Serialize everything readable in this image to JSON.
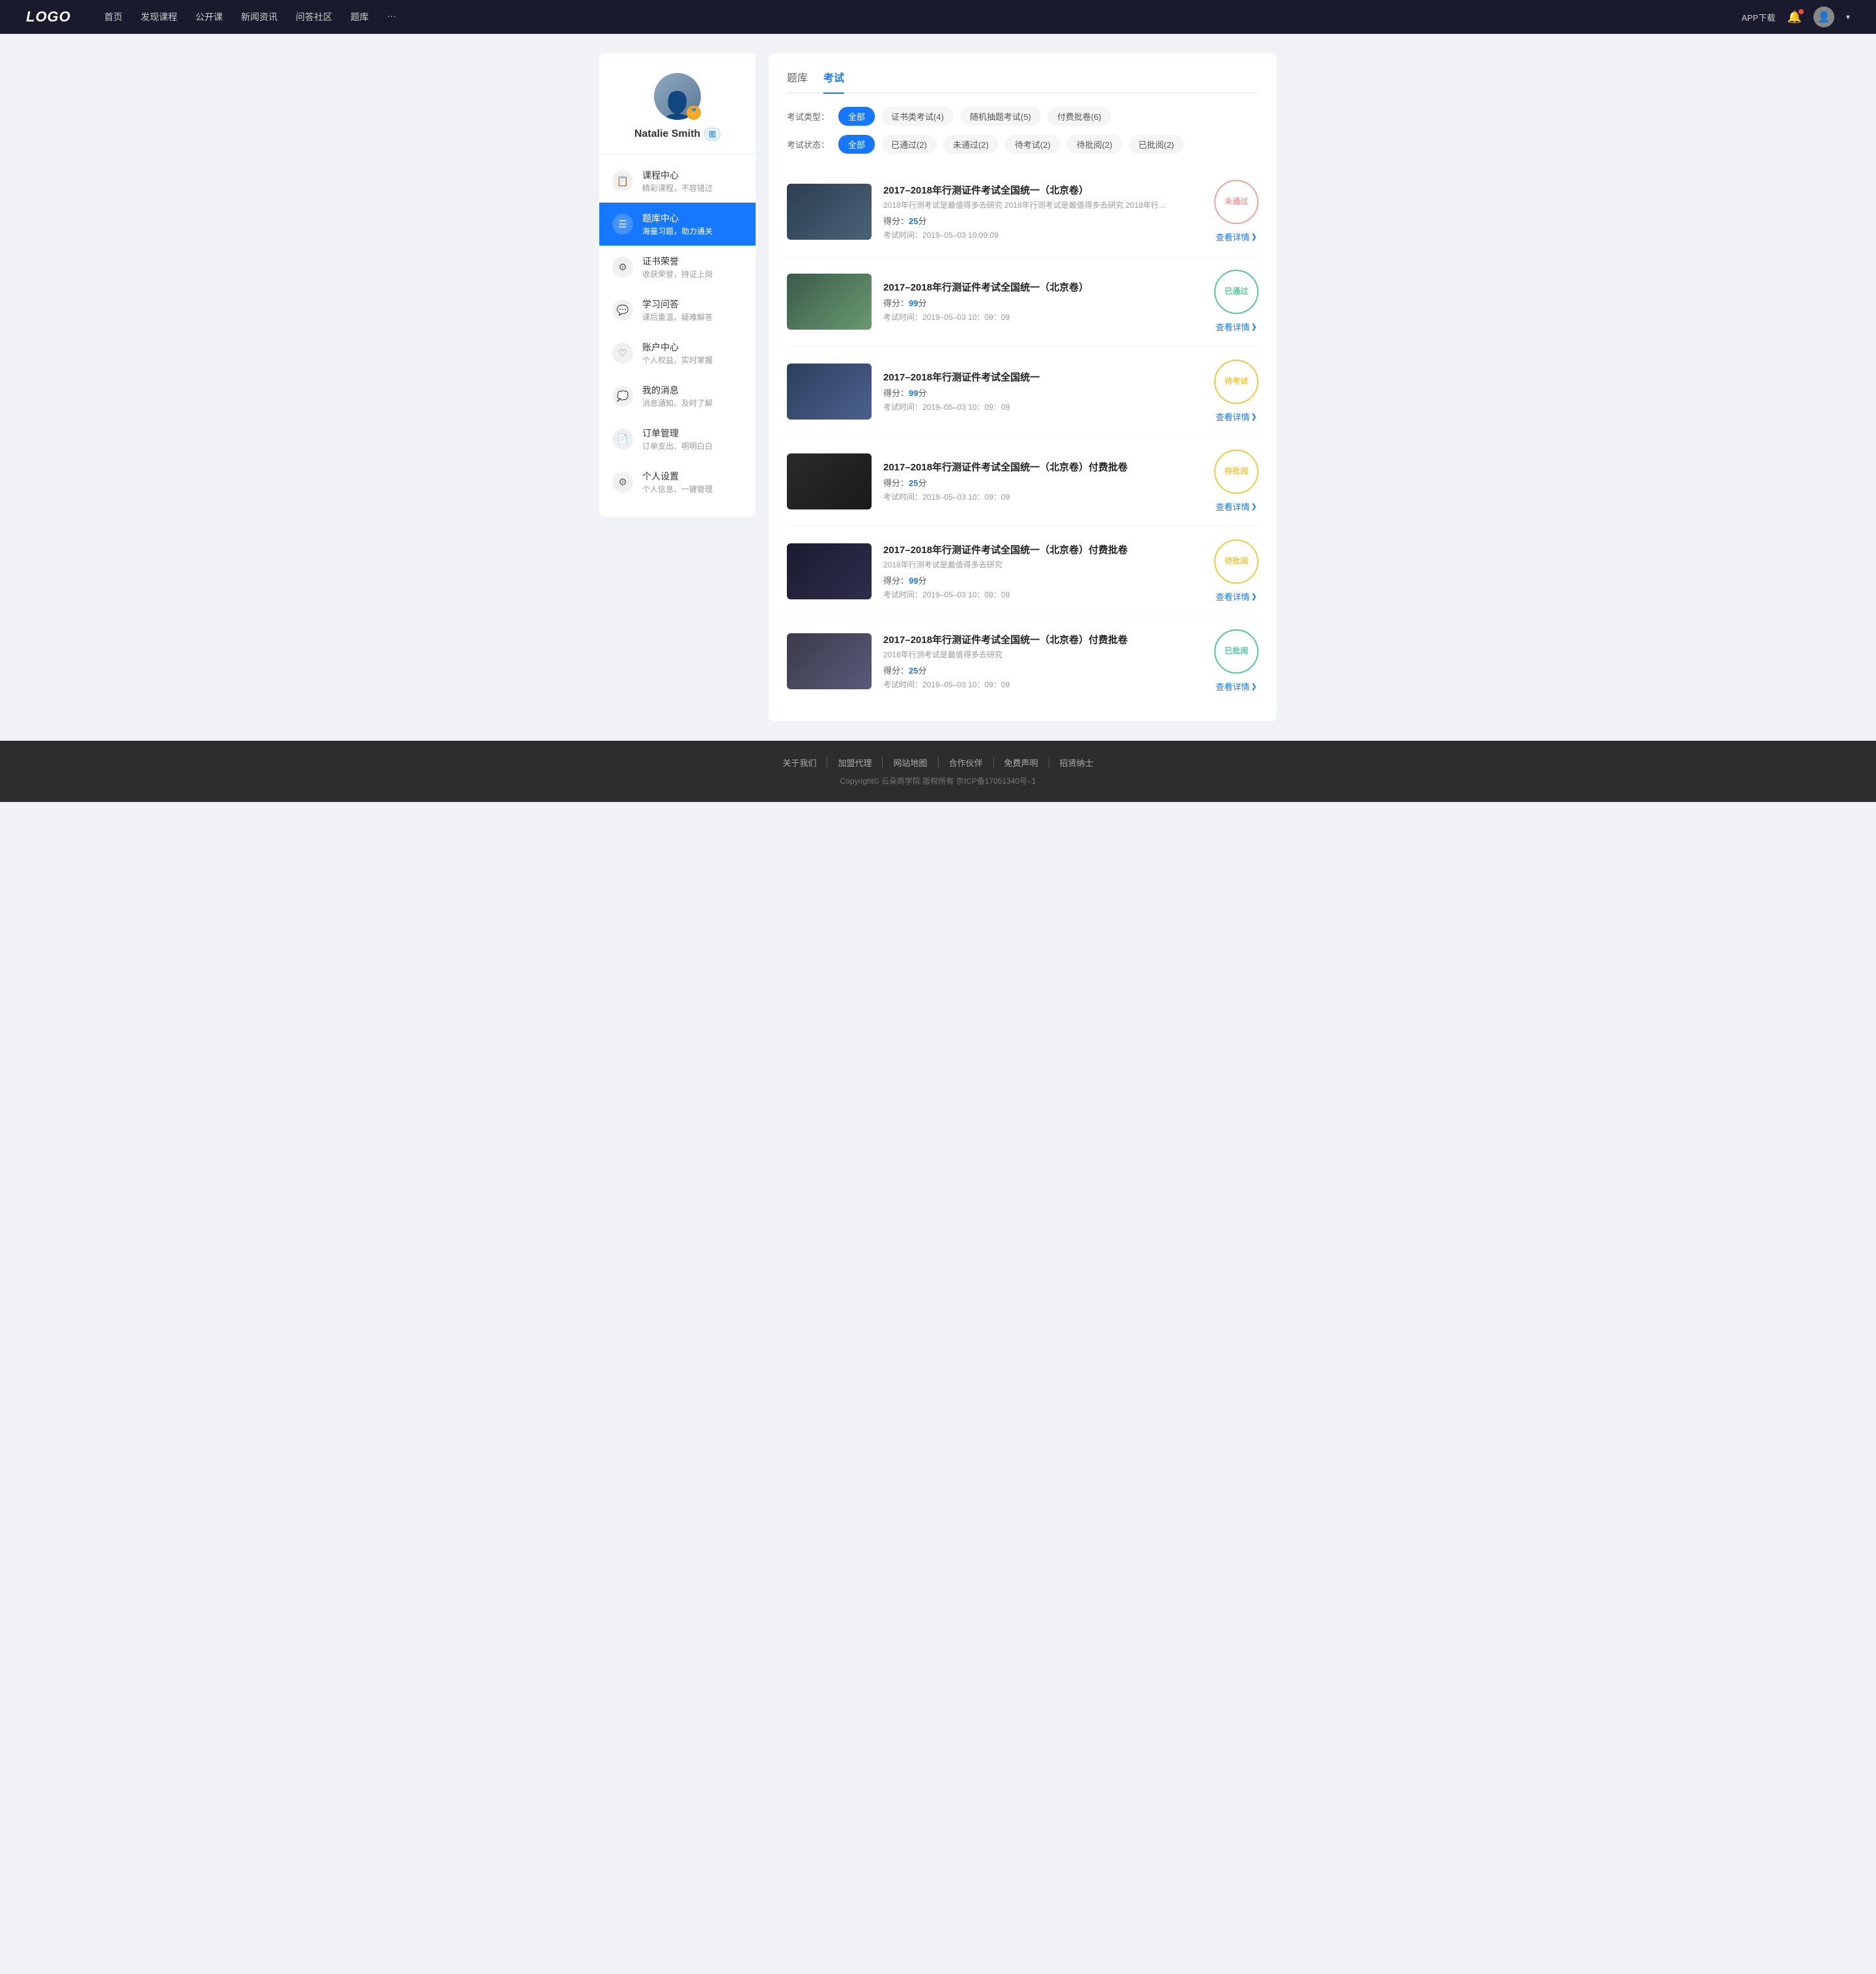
{
  "navbar": {
    "logo": "LOGO",
    "links": [
      "首页",
      "发现课程",
      "公开课",
      "新闻资讯",
      "问答社区",
      "题库",
      "···"
    ],
    "app_btn": "APP下载",
    "user_name": "Natalie Smith"
  },
  "sidebar": {
    "user_name": "Natalie Smith",
    "user_badge": "图",
    "menu_items": [
      {
        "id": "course-center",
        "icon": "📋",
        "title": "课程中心",
        "sub": "精彩课程，不容错过",
        "active": false
      },
      {
        "id": "question-bank",
        "icon": "☰",
        "title": "题库中心",
        "sub": "海量习题，助力通关",
        "active": true
      },
      {
        "id": "certificates",
        "icon": "⚙",
        "title": "证书荣誉",
        "sub": "收获荣誉，持证上岗",
        "active": false
      },
      {
        "id": "qa",
        "icon": "💬",
        "title": "学习问答",
        "sub": "课后重温、疑难解答",
        "active": false
      },
      {
        "id": "account",
        "icon": "♡",
        "title": "账户中心",
        "sub": "个人权益、实时掌握",
        "active": false
      },
      {
        "id": "messages",
        "icon": "💭",
        "title": "我的消息",
        "sub": "消息通知、及时了解",
        "active": false
      },
      {
        "id": "orders",
        "icon": "📄",
        "title": "订单管理",
        "sub": "订单支出、明明白白",
        "active": false
      },
      {
        "id": "settings",
        "icon": "⚙",
        "title": "个人设置",
        "sub": "个人信息、一键管理",
        "active": false
      }
    ]
  },
  "content": {
    "tabs": [
      {
        "label": "题库",
        "active": false
      },
      {
        "label": "考试",
        "active": true
      }
    ],
    "filter_type_label": "考试类型：",
    "filter_type_options": [
      {
        "label": "全部",
        "active": true
      },
      {
        "label": "证书类考试(4)",
        "active": false
      },
      {
        "label": "随机抽题考试(5)",
        "active": false
      },
      {
        "label": "付费批卷(6)",
        "active": false
      }
    ],
    "filter_status_label": "考试状态：",
    "filter_status_options": [
      {
        "label": "全部",
        "active": true
      },
      {
        "label": "已通过(2)",
        "active": false
      },
      {
        "label": "未通过(2)",
        "active": false
      },
      {
        "label": "待考试(2)",
        "active": false
      },
      {
        "label": "待批阅(2)",
        "active": false
      },
      {
        "label": "已批阅(2)",
        "active": false
      }
    ],
    "exam_items": [
      {
        "id": 1,
        "title": "2017–2018年行测证件考试全国统一（北京卷）",
        "desc": "2018年行测考试是最值得多去研究 2018年行测考试是最值得多去研究 2018年行…",
        "score": "25",
        "time": "2019–05–03  10:09:09",
        "stamp_type": "not-pass",
        "stamp_text": "未通过",
        "thumb_class": "thumb-1",
        "view_detail": "查看详情"
      },
      {
        "id": 2,
        "title": "2017–2018年行测证件考试全国统一（北京卷）",
        "desc": "",
        "score": "99",
        "time": "2019–05–03  10：09：09",
        "stamp_type": "passed",
        "stamp_text": "已通过",
        "thumb_class": "thumb-2",
        "view_detail": "查看详情"
      },
      {
        "id": 3,
        "title": "2017–2018年行测证件考试全国统一",
        "desc": "",
        "score": "99",
        "time": "2019–05–03  10：09：09",
        "stamp_type": "pending",
        "stamp_text": "待考试",
        "thumb_class": "thumb-3",
        "view_detail": "查看详情"
      },
      {
        "id": 4,
        "title": "2017–2018年行测证件考试全国统一（北京卷）付费批卷",
        "desc": "",
        "score": "25",
        "time": "2019–05–03  10：09：09",
        "stamp_type": "review-pending",
        "stamp_text": "待批阅",
        "thumb_class": "thumb-4",
        "view_detail": "查看详情"
      },
      {
        "id": 5,
        "title": "2017–2018年行测证件考试全国统一（北京卷）付费批卷",
        "desc": "2018年行测考试是最值得多去研究",
        "score": "99",
        "time": "2019–05–03  10：09：09",
        "stamp_type": "review-pending",
        "stamp_text": "待批阅",
        "thumb_class": "thumb-5",
        "view_detail": "查看详情"
      },
      {
        "id": 6,
        "title": "2017–2018年行测证件考试全国统一（北京卷）付费批卷",
        "desc": "2018年行测考试是最值得多去研究",
        "score": "25",
        "time": "2019–05–03  10：09：09",
        "stamp_type": "reviewed",
        "stamp_text": "已批阅",
        "thumb_class": "thumb-6",
        "view_detail": "查看详情"
      }
    ]
  },
  "footer": {
    "links": [
      "关于我们",
      "加盟代理",
      "网站地图",
      "合作伙伴",
      "免费声明",
      "招贤纳士"
    ],
    "copyright": "Copyright© 云朵商学院  版权所有   京ICP备17051340号–1"
  }
}
